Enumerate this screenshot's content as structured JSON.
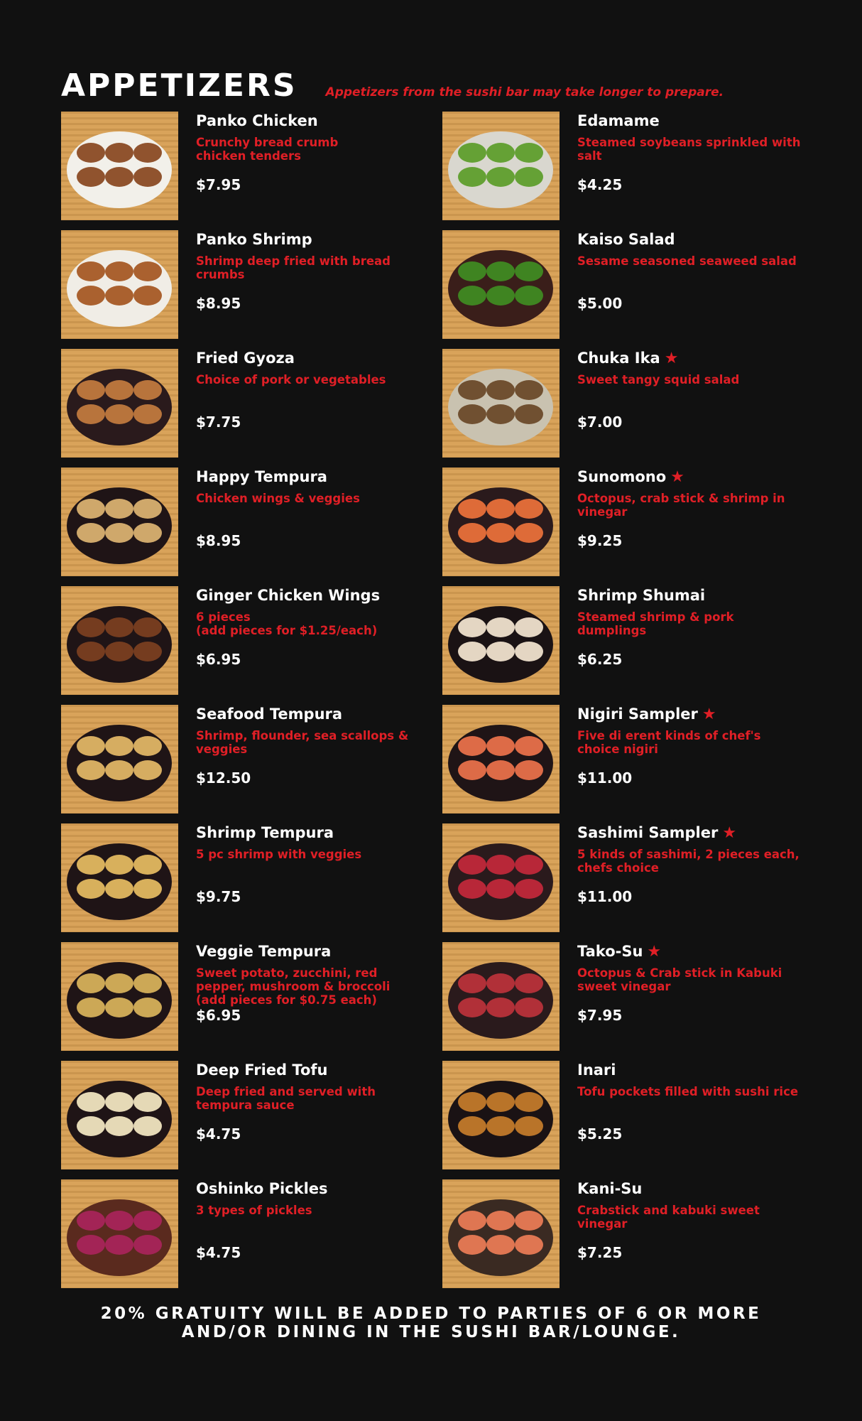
{
  "header": {
    "title": "APPETIZERS",
    "subtitle": "Appetizers from the sushi bar may take longer to prepare."
  },
  "items": [
    {
      "name": "Panko Chicken",
      "desc": "Crunchy bread crumb\nchicken tenders",
      "price": "$7.95",
      "star": false,
      "icon": "panko-chicken-photo",
      "food": "#8a4a24",
      "plate": "#f2f0ea"
    },
    {
      "name": "Edamame",
      "desc": "Steamed soybeans sprinkled with salt",
      "price": "$4.25",
      "star": false,
      "icon": "edamame-photo",
      "food": "#5f9e2c",
      "plate": "#d9d7cf"
    },
    {
      "name": "Panko Shrimp",
      "desc": "Shrimp deep fried with bread crumbs",
      "price": "$8.95",
      "star": false,
      "icon": "panko-shrimp-photo",
      "food": "#a55a25",
      "plate": "#f0ede6"
    },
    {
      "name": "Kaiso Salad",
      "desc": "Sesame seasoned seaweed salad",
      "price": "$5.00",
      "star": false,
      "icon": "kaiso-salad-photo",
      "food": "#3f8a22",
      "plate": "#3a1e1a"
    },
    {
      "name": "Fried Gyoza",
      "desc": "Choice of pork or vegetables",
      "price": "$7.75",
      "star": false,
      "icon": "fried-gyoza-photo",
      "food": "#c0793e",
      "plate": "#2a1a1c"
    },
    {
      "name": "Chuka Ika",
      "desc": "Sweet tangy squid salad",
      "price": "$7.00",
      "star": true,
      "icon": "chuka-ika-photo",
      "food": "#6b4a2a",
      "plate": "#c9c2b0"
    },
    {
      "name": "Happy Tempura",
      "desc": "Chicken wings & veggies",
      "price": "$8.95",
      "star": false,
      "icon": "happy-tempura-photo",
      "food": "#d9b070",
      "plate": "#1f1416"
    },
    {
      "name": "Sunomono",
      "desc": "Octopus, crab stick & shrimp in vinegar",
      "price": "$9.25",
      "star": true,
      "icon": "sunomono-photo",
      "food": "#e8703a",
      "plate": "#2a1a1c"
    },
    {
      "name": "Ginger Chicken Wings",
      "desc": "6 pieces\n(add pieces for $1.25/each)",
      "price": "$6.95",
      "star": false,
      "icon": "ginger-chicken-wings-photo",
      "food": "#7a3e20",
      "plate": "#1f1416"
    },
    {
      "name": "Shrimp Shumai",
      "desc": "Steamed shrimp & pork dumplings",
      "price": "$6.25",
      "star": false,
      "icon": "shrimp-shumai-photo",
      "food": "#efe2cc",
      "plate": "#1a1214"
    },
    {
      "name": "Seafood Tempura",
      "desc": "Shrimp, flounder, sea scallops & veggies",
      "price": "$12.50",
      "star": false,
      "icon": "seafood-tempura-photo",
      "food": "#e0b565",
      "plate": "#1f1416"
    },
    {
      "name": "Nigiri Sampler",
      "desc": "Five di erent kinds of chef's choice nigiri",
      "price": "$11.00",
      "star": true,
      "icon": "nigiri-sampler-photo",
      "food": "#e8704a",
      "plate": "#1f1416"
    },
    {
      "name": "Shrimp Tempura",
      "desc": "5 pc shrimp with veggies",
      "price": "$9.75",
      "star": false,
      "icon": "shrimp-tempura-photo",
      "food": "#e3b860",
      "plate": "#1f1416"
    },
    {
      "name": "Sashimi Sampler",
      "desc": "5 kinds of sashimi, 2 pieces each, chefs choice",
      "price": "$11.00",
      "star": true,
      "icon": "sashimi-sampler-photo",
      "food": "#c0283a",
      "plate": "#2a1a1c"
    },
    {
      "name": "Veggie Tempura",
      "desc": "Sweet potato, zucchini, red pepper, mushroom & broccoli\n(add pieces for $0.75 each)",
      "price": "$6.95",
      "star": false,
      "icon": "veggie-tempura-photo",
      "food": "#d6b05a",
      "plate": "#1f1416"
    },
    {
      "name": "Tako-Su",
      "desc": "Octopus & Crab stick in Kabuki sweet vinegar",
      "price": "$7.95",
      "star": true,
      "icon": "tako-su-photo",
      "food": "#b8323a",
      "plate": "#2a1a1c"
    },
    {
      "name": "Deep Fried Tofu",
      "desc": "Deep fried and served with tempura sauce",
      "price": "$4.75",
      "star": false,
      "icon": "deep-fried-tofu-photo",
      "food": "#f0e4bf",
      "plate": "#1f1416"
    },
    {
      "name": "Inari",
      "desc": "Tofu pockets filled with sushi rice",
      "price": "$5.25",
      "star": false,
      "icon": "inari-photo",
      "food": "#c27a2a",
      "plate": "#1a1214"
    },
    {
      "name": "Oshinko Pickles",
      "desc": "3 types of pickles",
      "price": "$4.75",
      "star": false,
      "icon": "oshinko-pickles-photo",
      "food": "#a8245a",
      "plate": "#5a2a1e"
    },
    {
      "name": "Kani-Su",
      "desc": "Crabstick and kabuki sweet vinegar",
      "price": "$7.25",
      "star": false,
      "icon": "kani-su-photo",
      "food": "#e87a55",
      "plate": "#3a2a22"
    }
  ],
  "footer": {
    "line1": "20% GRATUITY WILL BE ADDED TO PARTIES OF 6 OR MORE",
    "line2": "AND/OR DINING IN THE SUSHI BAR/LOUNGE."
  },
  "colors": {
    "background": "#111111",
    "accent": "#e01f26",
    "text": "#ffffff",
    "mat": "#d9a35a"
  }
}
